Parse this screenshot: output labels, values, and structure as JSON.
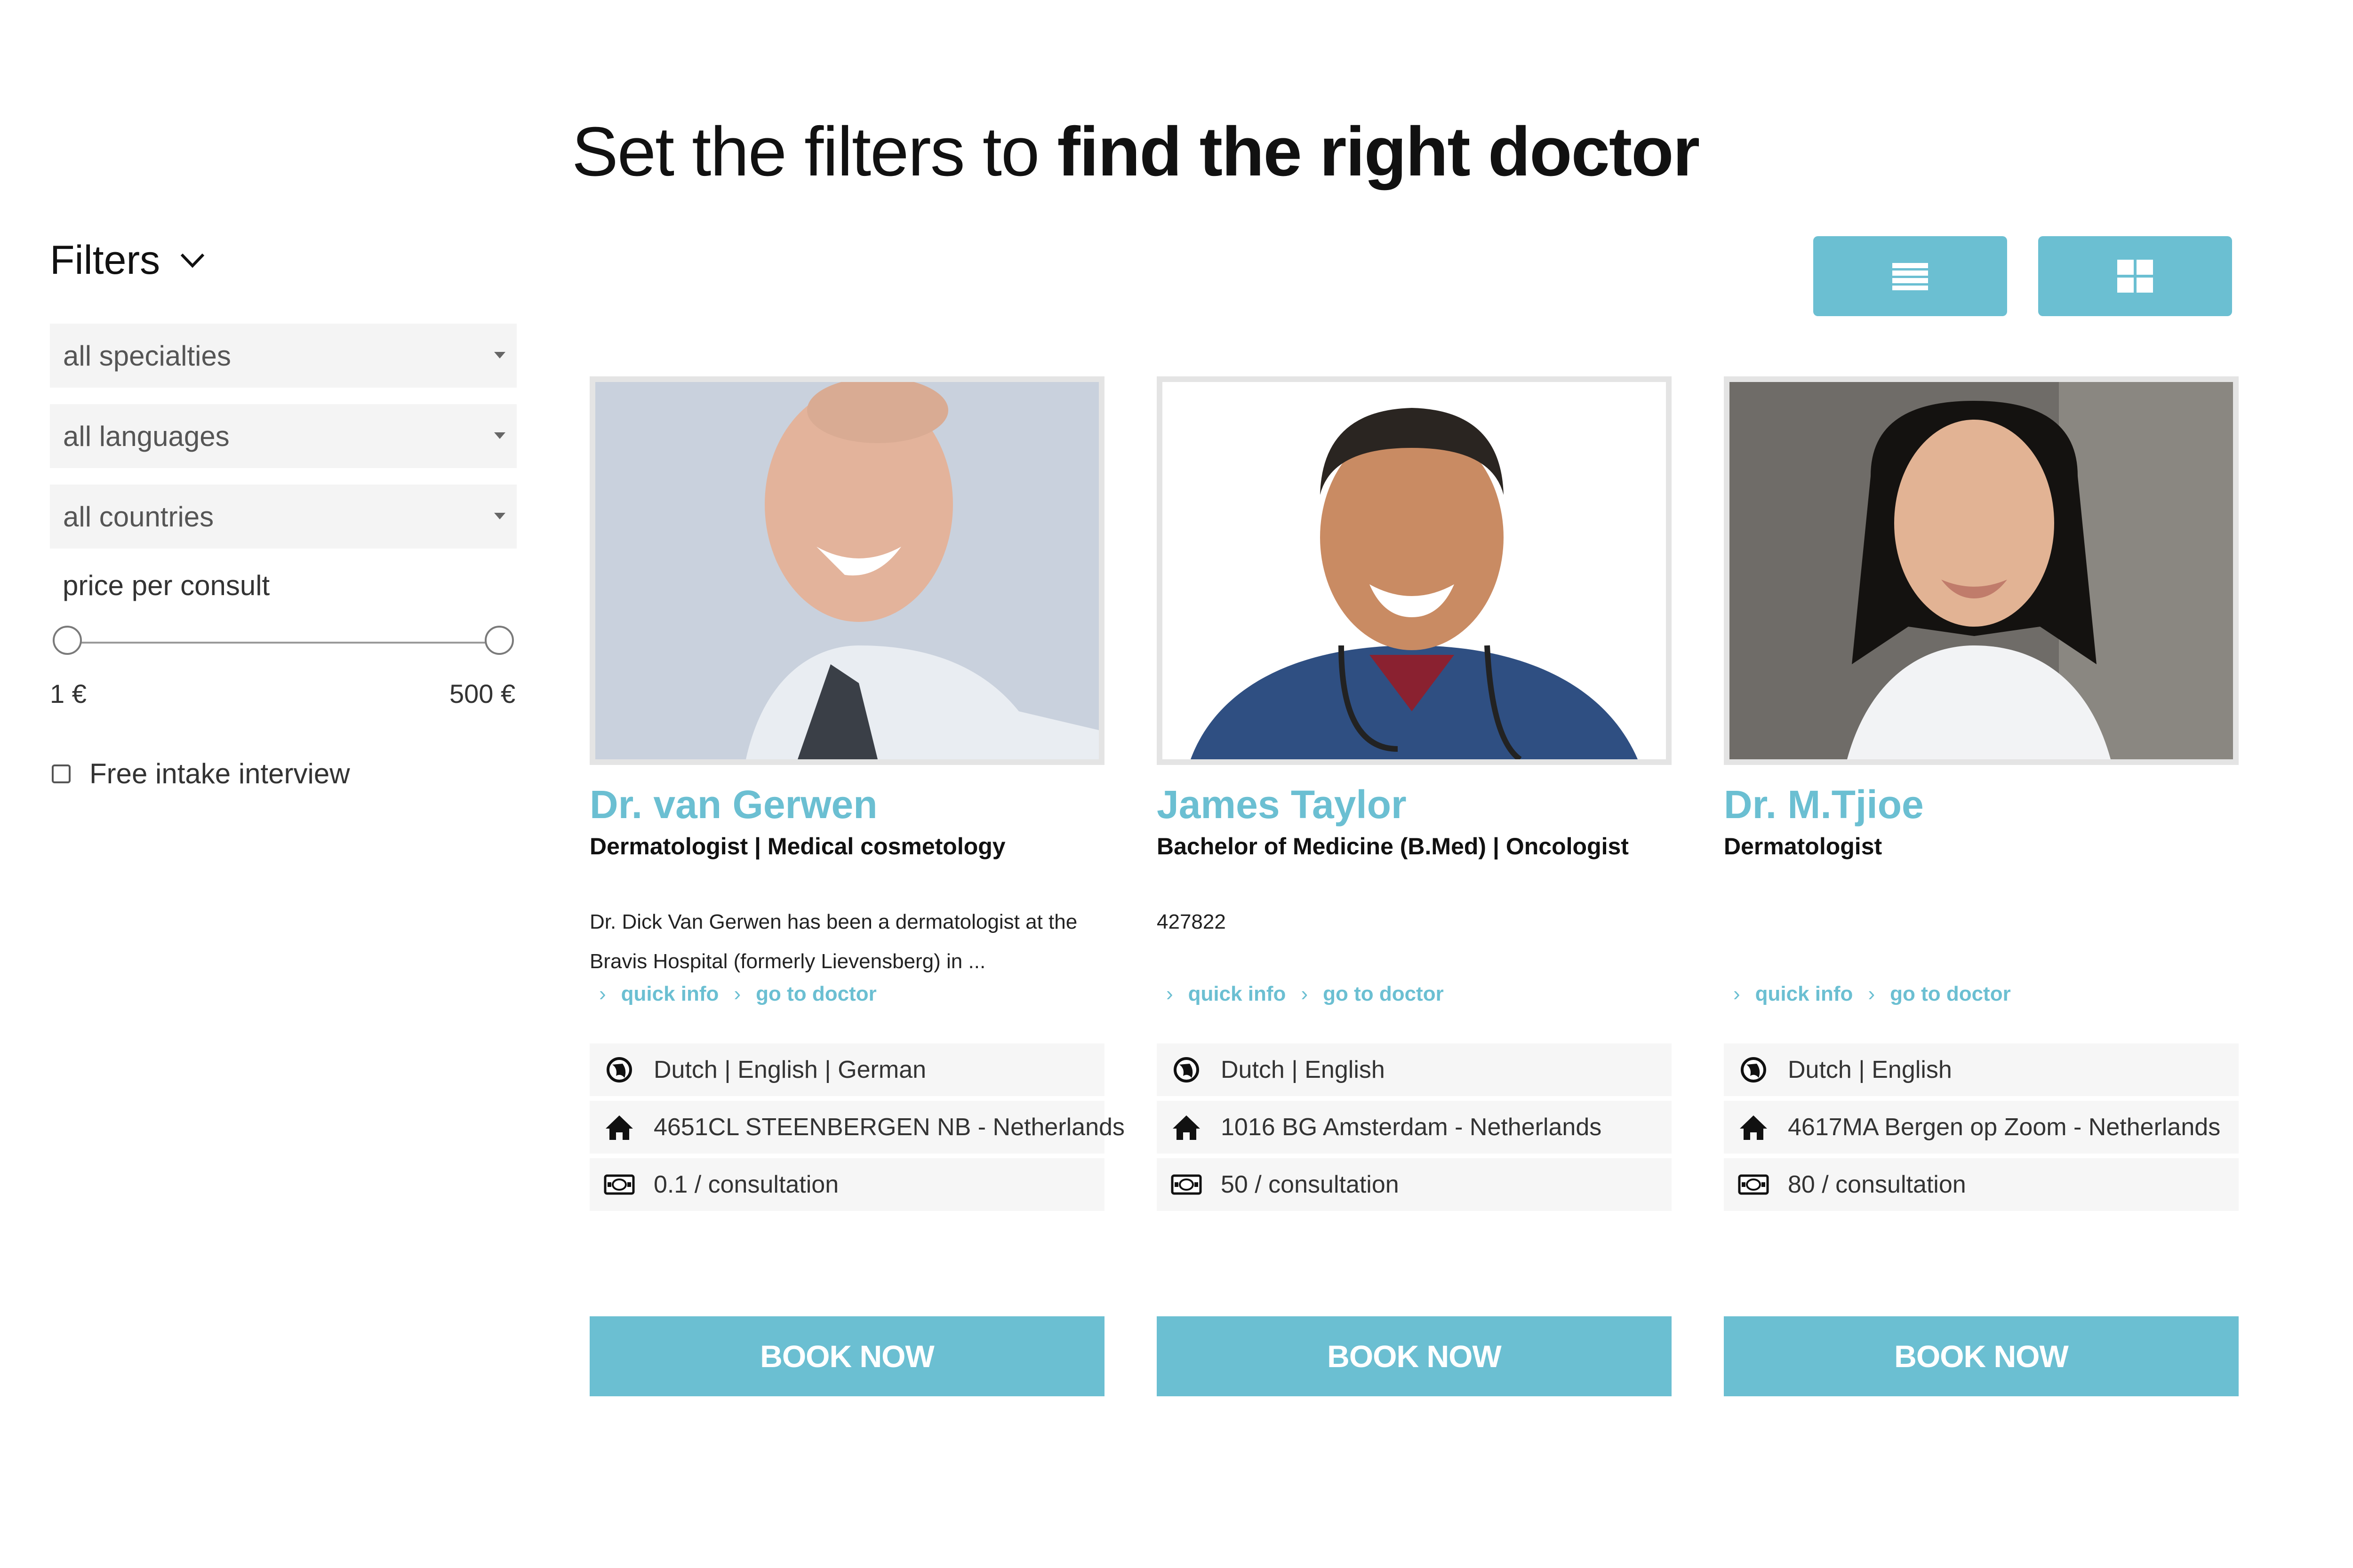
{
  "page": {
    "title_plain": "Set the filters to",
    "title_bold": "find the right doctor"
  },
  "filters": {
    "heading": "Filters",
    "specialties": "all specialties",
    "languages": "all languages",
    "countries": "all countries",
    "price_label": "price per consult",
    "price_min": "1 €",
    "price_max": "500 €",
    "price_range_fraction": [
      0,
      1
    ],
    "free_intake_label": "Free intake interview",
    "free_intake_checked": false
  },
  "view_toggle": {
    "list_icon": "list-view-icon",
    "grid_icon": "grid-view-icon",
    "color": "#6bbfd2"
  },
  "doctors": [
    {
      "name": "Dr. van Gerwen",
      "specialties": "Dermatologist  | Medical cosmetology",
      "description": "Dr. Dick Van Gerwen has been a dermatologist at the Bravis Hospital (formerly Lievensberg) in ...",
      "quick_info": "quick info",
      "go_to_doctor": "go to doctor",
      "languages": "Dutch  | English  | German",
      "address": "4651CL STEENBERGEN NB - Netherlands",
      "price": "0.1 / consultation",
      "book": "BOOK NOW"
    },
    {
      "name": "James Taylor",
      "specialties": "Bachelor of Medicine (B.Med)  | Oncologist",
      "description": "427822",
      "quick_info": "quick info",
      "go_to_doctor": "go to doctor",
      "languages": "Dutch  | English",
      "address": "1016 BG Amsterdam - Netherlands",
      "price": "50 / consultation",
      "book": "BOOK NOW"
    },
    {
      "name": "Dr. M.Tjioe",
      "specialties": "Dermatologist",
      "description": "",
      "quick_info": "quick info",
      "go_to_doctor": "go to doctor",
      "languages": "Dutch  | English",
      "address": "4617MA Bergen op Zoom - Netherlands",
      "price": "80 / consultation",
      "book": "BOOK NOW"
    }
  ],
  "icons": {
    "language": "globe-icon",
    "address": "home-icon",
    "price": "money-icon"
  },
  "colors": {
    "accent": "#6bbfd2",
    "row_bg": "#f6f6f6"
  }
}
